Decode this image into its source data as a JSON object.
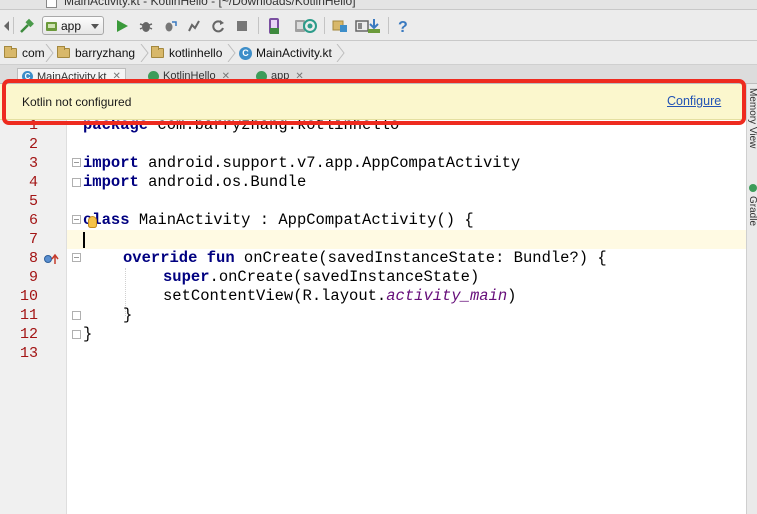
{
  "window": {
    "title": "MainActivity.kt - KotlinHello - [~/Downloads/KotlinHello]"
  },
  "toolbar": {
    "run_config": "app",
    "icons": [
      "build-hammer-icon",
      "run-icon",
      "debug-icon",
      "attach-debugger-icon",
      "apply-changes-icon",
      "stop-icon",
      "avd-manager-icon",
      "sync-gradle-icon",
      "project-structure-icon",
      "sdk-manager-icon",
      "help-icon"
    ]
  },
  "breadcrumb": {
    "items": [
      "com",
      "barryzhang",
      "kotlinhello",
      "MainActivity.kt"
    ]
  },
  "tabs": [
    {
      "label": "MainActivity.kt",
      "active": true
    },
    {
      "label": "KotlinHello",
      "active": false
    },
    {
      "label": "app",
      "active": false
    }
  ],
  "banner": {
    "message": "Kotlin not configured",
    "action": "Configure",
    "highlight_color": "#ee2b1f",
    "background_color": "#fbf7cd"
  },
  "right_strip": {
    "items": [
      "Memory View",
      "Gradle"
    ]
  },
  "editor": {
    "line_numbers": [
      "1",
      "2",
      "3",
      "4",
      "5",
      "6",
      "7",
      "8",
      "9",
      "10",
      "11",
      "12",
      "13"
    ],
    "current_line": 7,
    "lines": {
      "l1": {
        "kw": "package",
        "rest": " com.barryzhang.kotlinhello"
      },
      "l3": {
        "kw": "import",
        "rest": " android.support.v7.app.AppCompatActivity"
      },
      "l4": {
        "kw": "import",
        "rest": " android.os.Bundle"
      },
      "l6": {
        "kw": "class",
        "rest": " MainActivity : AppCompatActivity() {"
      },
      "l8": {
        "kw": "override fun",
        "rest": " onCreate(savedInstanceState: Bundle?) {"
      },
      "l9": {
        "kw": "super",
        "rest": ".onCreate(savedInstanceState)"
      },
      "l10": {
        "pre": "setContentView(R.layout.",
        "it": "activity_main",
        "post": ")"
      },
      "l11": {
        "text": "}"
      },
      "l12": {
        "text": "}"
      }
    }
  }
}
